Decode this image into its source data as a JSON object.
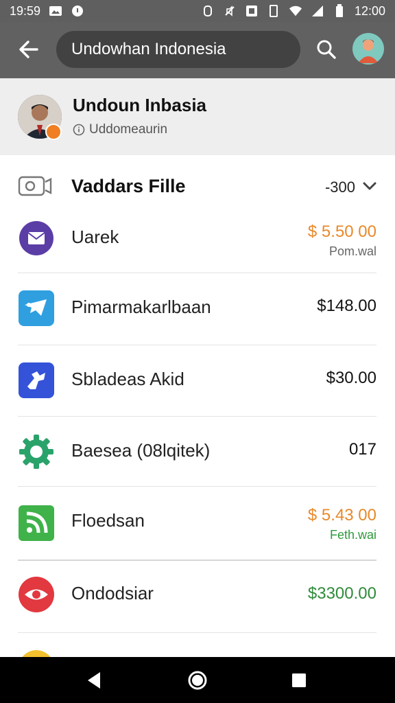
{
  "status_bar": {
    "time": "19:59",
    "clock": "12:00"
  },
  "toolbar": {
    "search_text": "Undowhan Indonesia"
  },
  "profile": {
    "name": "Undoun Inbasia",
    "subtitle": "Uddomeaurin"
  },
  "section": {
    "title": "Vaddars Fille",
    "amount": "-300"
  },
  "items": [
    {
      "label": "Uarek",
      "amount": "$ 5.50 00",
      "sub": "Pom.wal",
      "amount_color": "#e8892a",
      "sub_color": "#666666",
      "icon": "envelope-icon"
    },
    {
      "label": "Pimarmakarlbaan",
      "amount": "$148.00",
      "sub": "",
      "amount_color": "#111111",
      "sub_color": "#666666",
      "icon": "message-bird-icon"
    },
    {
      "label": "Sbladeas Akid",
      "amount": "$30.00",
      "sub": "",
      "amount_color": "#111111",
      "sub_color": "#666666",
      "icon": "puzzle-app-icon"
    },
    {
      "label": "Baesea (08lqitek)",
      "amount": "017",
      "sub": "",
      "amount_color": "#111111",
      "sub_color": "#666666",
      "icon": "gear-icon"
    },
    {
      "label": "Floedsan",
      "amount": "$ 5.43 00",
      "sub": "Feth.wai",
      "amount_color": "#e8892a",
      "sub_color": "#2e9a3c",
      "icon": "feed-icon"
    },
    {
      "label": "Ondodsiar",
      "amount": "$3300.00",
      "sub": "",
      "amount_color": "#2e8b3a",
      "sub_color": "#666666",
      "icon": "eye-icon"
    }
  ],
  "colors": {
    "status_bar": "#5f5f5f",
    "toolbar": "#616161",
    "header_bg": "#eeeeee",
    "orange": "#e8892a",
    "green": "#2e8b3a"
  }
}
